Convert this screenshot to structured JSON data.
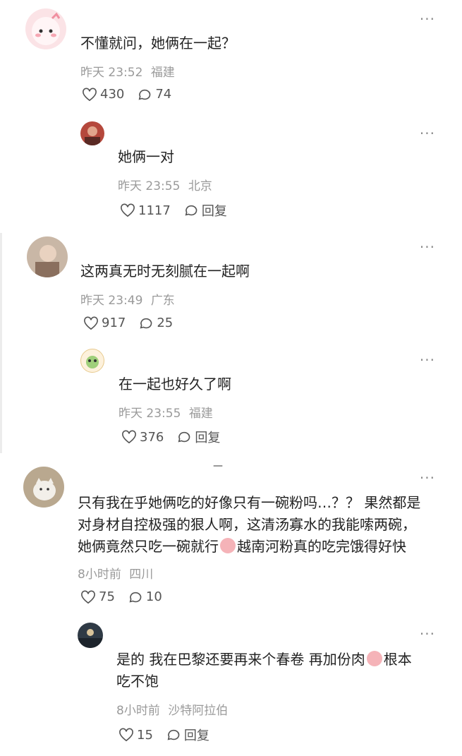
{
  "comments": [
    {
      "text": "不懂就问，她俩在一起？",
      "time": "昨天 23:52",
      "location": "福建",
      "likes": "430",
      "replies": "74",
      "reply": {
        "text": "她俩一对",
        "time": "昨天 23:55",
        "location": "北京",
        "likes": "1117",
        "reply_label": "回复"
      }
    },
    {
      "text": "这两真无时无刻腻在一起啊",
      "time": "昨天 23:49",
      "location": "广东",
      "likes": "917",
      "replies": "25",
      "reply": {
        "text": "在一起也好久了啊",
        "time": "昨天 23:55",
        "location": "福建",
        "likes": "376",
        "reply_label": "回复"
      }
    },
    {
      "text_lines": [
        "只有我在乎她俩吃的好像只有一碗粉吗…？？ 果然都是",
        "对身材自控极强的狠人啊，这清汤寡水的我能嗦两碗，",
        "她俩竟然只吃一碗就行",
        "越南河粉真的吃完饿得好快"
      ],
      "time": "8小时前",
      "location": "四川",
      "likes": "75",
      "replies": "10",
      "reply": {
        "text_lines": [
          "是的 我在巴黎还要再来个春卷 再加份肉",
          "根本",
          "吃不饱"
        ],
        "time": "8小时前",
        "location": "沙特阿拉伯",
        "likes": "15",
        "reply_label": "回复"
      }
    }
  ],
  "more_label": "···",
  "separator": "—"
}
